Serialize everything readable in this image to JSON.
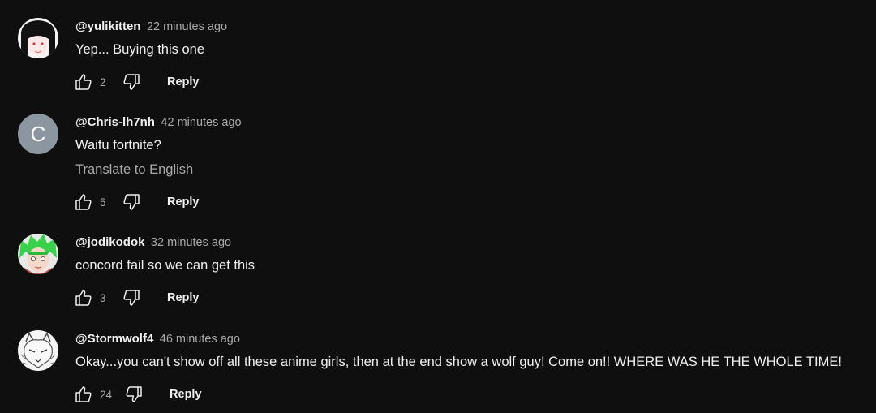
{
  "comments": [
    {
      "author": "@yulikitten",
      "time": "22 minutes ago",
      "text": "Yep... Buying this one",
      "likes": "2",
      "reply_label": "Reply"
    },
    {
      "author": "@Chris-lh7nh",
      "time": "42 minutes ago",
      "text": "Waifu fortnite?",
      "translate_label": "Translate to English",
      "avatar_letter": "C",
      "likes": "5",
      "reply_label": "Reply"
    },
    {
      "author": "@jodikodok",
      "time": "32 minutes ago",
      "text": "concord fail so we can get this",
      "likes": "3",
      "reply_label": "Reply"
    },
    {
      "author": "@Stormwolf4",
      "time": "46 minutes ago",
      "text": "Okay...you can't show off all these anime girls, then at the end show a wolf guy! Come on!! WHERE WAS HE THE WHOLE TIME!",
      "likes": "24",
      "reply_label": "Reply"
    }
  ],
  "icons": {
    "like": "thumbs-up-icon",
    "dislike": "thumbs-down-icon"
  },
  "colors": {
    "background": "#0f0f0f",
    "text": "#f1f1f1",
    "secondary": "#aaaaaa",
    "letter_avatar": "#8b96a1"
  }
}
